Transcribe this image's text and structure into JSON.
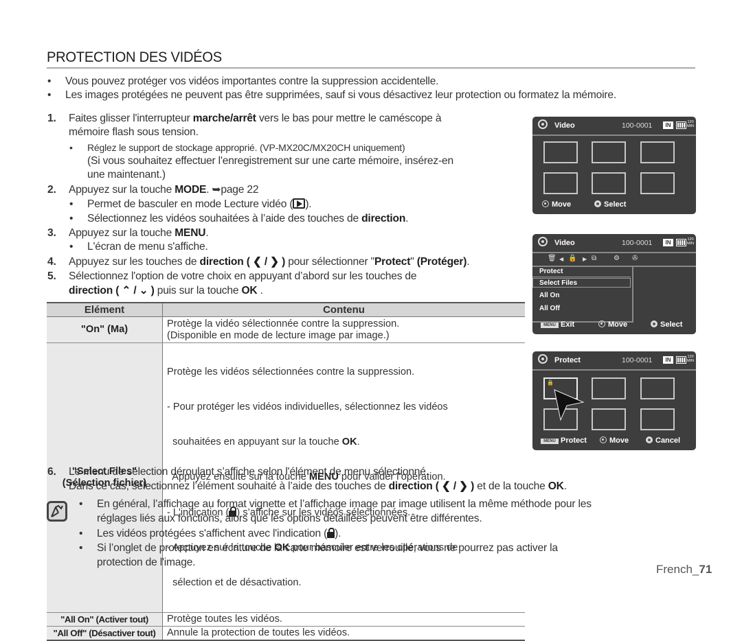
{
  "page": {
    "title": "PROTECTION DES VIDÉOS",
    "intro_bullets": [
      "Vous pouvez protéger vos vidéos importantes contre la suppression accidentelle.",
      "Les images protégées ne peuvent pas être supprimées, sauf si vous désactivez leur protection ou formatez la mémoire."
    ],
    "steps": {
      "s1": {
        "num": "1.",
        "pre": "Faites glisser l'interrupteur ",
        "bold": "marche/arrêt",
        "post": " vers le bas pour mettre le caméscope à",
        "line2": "mémoire flash sous tension.",
        "sub1": "Réglez le support de stockage approprié. (VP-MX20C/MX20CH uniquement)",
        "sub2": "(Si vous souhaitez effectuer l'enregistrement sur une carte mémoire, insérez-en",
        "sub3": "une maintenant.)"
      },
      "s2": {
        "num": "2.",
        "pre": "Appuyez sur la touche ",
        "bold": "MODE",
        "post": ". ➥page 22",
        "sub1_pre": "Permet de basculer en mode Lecture vidéo (",
        "sub1_post": ").",
        "sub2_pre": "Sélectionnez les vidéos souhaitées à l’aide des touches de ",
        "sub2_bold": "direction",
        "sub2_post": "."
      },
      "s3": {
        "num": "3.",
        "pre": "Appuyez sur la touche ",
        "bold": "MENU",
        "post": ".",
        "sub1": "L'écran de menu s'affiche."
      },
      "s4": {
        "num": "4.",
        "pre": "Appuyez sur les touches de ",
        "bold": "direction",
        "arrows": " ( ❮ / ❯ ) ",
        "mid": "pour sélectionner \"",
        "bold2": "Protect",
        "mid2": "\" ",
        "bold3": "(Protéger)",
        "post": "."
      },
      "s5": {
        "num": "5.",
        "line1": "Sélectionnez l'option de votre choix en appuyant d’abord sur les touches de",
        "bold": "direction",
        "arrows": " ( ⌃ / ⌄ ) ",
        "mid": "puis sur la touche ",
        "bold2": "OK",
        "post": " ."
      },
      "s6": {
        "num": "6.",
        "line1": "Le menu de sélection déroulant s’affiche selon l'élément de menu sélectionné.",
        "pre2": "Dans ce cas, sélectionnez l’élément souhaité à l’aide des touches de ",
        "bold": "direction",
        "arrows": " ( ❮ / ❯ ) ",
        "mid": "et de la touche ",
        "bold2": "OK",
        "post": "."
      }
    },
    "table": {
      "headers": [
        "Elément",
        "Contenu"
      ],
      "rows": [
        {
          "key": "\"On\" (Ma)",
          "lines": [
            "Protège la vidéo sélectionnée contre la suppression.",
            "(Disponible en mode de lecture image par image.)"
          ]
        },
        {
          "key1": "\"Select Files\"",
          "key2": "(Sélection fichier)",
          "l1": "Protège les vidéos sélectionnées contre la suppression.",
          "l2": "- Pour protéger les vidéos individuelles, sélectionnez les vidéos",
          "l3_pre": "  souhaitées en appuyant sur la touche ",
          "l3_bold": "OK",
          "l3_post": ".",
          "l4_pre": "  Appuyez ensuite sur la touche ",
          "l4_bold": "MENU",
          "l4_post": " pour valider l’opération.",
          "l5_pre": "- L'indication (",
          "l5_post": ") s’affiche sur les vidéos sélectionnées.",
          "l6_pre": "- Appuyez sur la touche ",
          "l6_bold": "OK",
          "l6_post": " pour basculer entre les opérations de",
          "l7": "  sélection et de désactivation."
        },
        {
          "key": "\"All On\" (Activer tout)",
          "value": "Protège toutes les vidéos."
        },
        {
          "key": "\"All Off\" (Désactiver tout)",
          "value": "Annule la protection de toutes les vidéos."
        }
      ]
    },
    "notes": {
      "n1a": "En général, l’affichage au format vignette et l’affichage image par image utilisent la même méthode pour les",
      "n1b": "réglages liés aux fonctions, alors que les options détaillées peuvent être différentes.",
      "n2_pre": "Les vidéos protégées s'affichent avec l'indication (",
      "n2_post": ").",
      "n3a": "Si l’onglet de protection en écriture de la carte mémoire est verrouillé, vous ne pourrez pas activer la",
      "n3b": "protection de l'image."
    },
    "footer": {
      "lang": "French_",
      "page": "71"
    }
  },
  "screens": [
    {
      "title": "Video",
      "file": "100-0001",
      "storage": "IN",
      "remaining_top": "120",
      "remaining_bottom": "MIN",
      "footer": [
        "Move",
        "Select"
      ]
    },
    {
      "title": "Video",
      "file": "100-0001",
      "storage": "IN",
      "remaining_top": "120",
      "remaining_bottom": "MIN",
      "tab_icons": [
        "🗑",
        "◀",
        "🔒",
        "▶",
        "⧉",
        "⚙",
        "✇"
      ],
      "menu_header": "Protect",
      "menu_items": [
        "Select Files",
        "All On",
        "All Off"
      ],
      "selected_item": "Select Files",
      "footer": [
        "MENU",
        "Exit",
        "Move",
        "Select"
      ]
    },
    {
      "title": "Protect",
      "file": "100-0001",
      "storage": "IN",
      "remaining_top": "120",
      "remaining_bottom": "MIN",
      "footer": [
        "MENU",
        "Protect",
        "Move",
        "Cancel"
      ]
    }
  ]
}
